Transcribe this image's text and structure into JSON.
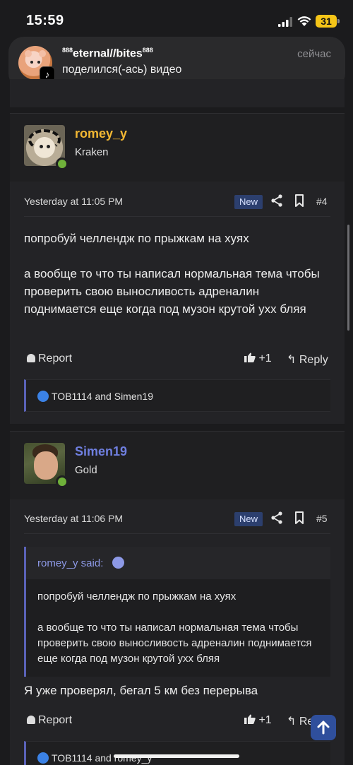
{
  "status_bar": {
    "time": "15:59",
    "battery": "31"
  },
  "notification": {
    "title_prefix": "888",
    "title_main": "eternal//bites",
    "title_suffix": "888",
    "text": "поделился(-ась) видео",
    "time": "сейчас"
  },
  "posts": [
    {
      "username": "romey_y",
      "username_color": "#f2b733",
      "user_title": "Kraken",
      "time": "Yesterday at 11:05 PM",
      "badge": "New",
      "number": "#4",
      "paragraph1": "попробуй челлендж по прыжкам на хуях",
      "paragraph2": "а вообще то что ты написал нормальная тема чтобы проверить свою выносливость адреналин поднимается еще когда под музон крутой ухх бляя",
      "report_label": "Report",
      "like_count": "+1",
      "reply_label": "Reply",
      "reactions": "TOB1114 and Simen19"
    },
    {
      "username": "Simen19",
      "username_color": "#6f7fe0",
      "user_title": "Gold",
      "time": "Yesterday at 11:06 PM",
      "badge": "New",
      "number": "#5",
      "quote_author": "romey_y said:",
      "quote_paragraph1": "попробуй челлендж по прыжкам на хуях",
      "quote_paragraph2": "а вообще то что ты написал нормальная тема чтобы проверить свою выносливость адреналин поднимается еще когда под музон крутой ухх бляя",
      "text": "Я уже проверял, бегал 5 км без перерыва",
      "report_label": "Report",
      "like_count": "+1",
      "reply_label": "Reply",
      "reactions": "TOB1114 and romey_y"
    }
  ]
}
